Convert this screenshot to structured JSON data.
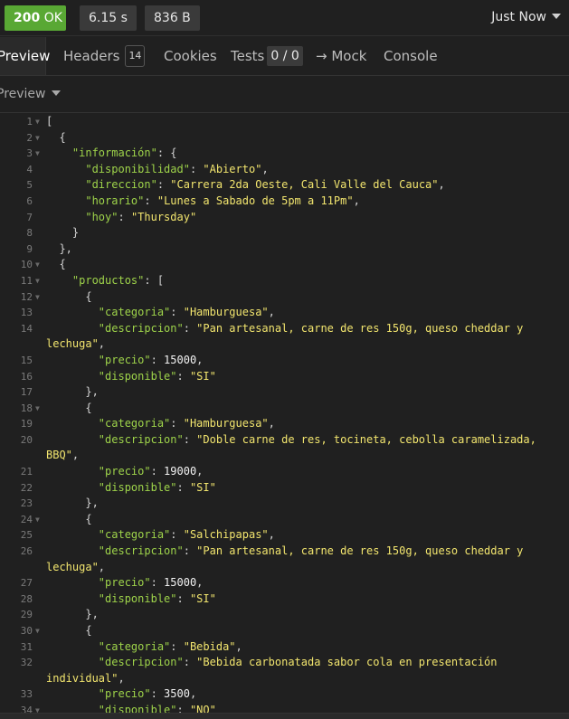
{
  "status": {
    "code": "200",
    "text": "OK",
    "time": "6.15 s",
    "size": "836 B",
    "timestamp": "Just Now"
  },
  "tabs": {
    "preview": "Preview",
    "headers": "Headers",
    "headers_count": "14",
    "cookies": "Cookies",
    "tests": "Tests",
    "tests_count": "0 / 0",
    "mock": "→ Mock",
    "console": "Console"
  },
  "preview_mode": "Preview",
  "colors": {
    "status_ok": "#59a834",
    "json_key": "#9ed34a",
    "json_string": "#f2e56e",
    "background": "#202020"
  },
  "icons": {
    "caret": "caret-down-icon",
    "fold": "fold-arrow-icon"
  },
  "code_lines": [
    {
      "n": "1",
      "fold": true,
      "t": [
        [
          "p",
          "["
        ]
      ]
    },
    {
      "n": "2",
      "fold": true,
      "t": [
        [
          "p",
          "  {"
        ]
      ]
    },
    {
      "n": "3",
      "fold": true,
      "t": [
        [
          "p",
          "    "
        ],
        [
          "k",
          "\"información\""
        ],
        [
          "p",
          ": {"
        ]
      ]
    },
    {
      "n": "4",
      "t": [
        [
          "p",
          "      "
        ],
        [
          "k",
          "\"disponibilidad\""
        ],
        [
          "p",
          ": "
        ],
        [
          "s",
          "\"Abierto\""
        ],
        [
          "p",
          ","
        ]
      ]
    },
    {
      "n": "5",
      "t": [
        [
          "p",
          "      "
        ],
        [
          "k",
          "\"direccion\""
        ],
        [
          "p",
          ": "
        ],
        [
          "s",
          "\"Carrera 2da Oeste, Cali Valle del Cauca\""
        ],
        [
          "p",
          ","
        ]
      ]
    },
    {
      "n": "6",
      "t": [
        [
          "p",
          "      "
        ],
        [
          "k",
          "\"horario\""
        ],
        [
          "p",
          ": "
        ],
        [
          "s",
          "\"Lunes a Sabado de 5pm a 11Pm\""
        ],
        [
          "p",
          ","
        ]
      ]
    },
    {
      "n": "7",
      "t": [
        [
          "p",
          "      "
        ],
        [
          "k",
          "\"hoy\""
        ],
        [
          "p",
          ": "
        ],
        [
          "s",
          "\"Thursday\""
        ]
      ]
    },
    {
      "n": "8",
      "t": [
        [
          "p",
          "    }"
        ]
      ]
    },
    {
      "n": "9",
      "t": [
        [
          "p",
          "  },"
        ]
      ]
    },
    {
      "n": "10",
      "fold": true,
      "t": [
        [
          "p",
          "  {"
        ]
      ]
    },
    {
      "n": "11",
      "fold": true,
      "t": [
        [
          "p",
          "    "
        ],
        [
          "k",
          "\"productos\""
        ],
        [
          "p",
          ": ["
        ]
      ]
    },
    {
      "n": "12",
      "fold": true,
      "t": [
        [
          "p",
          "      {"
        ]
      ]
    },
    {
      "n": "13",
      "t": [
        [
          "p",
          "        "
        ],
        [
          "k",
          "\"categoria\""
        ],
        [
          "p",
          ": "
        ],
        [
          "s",
          "\"Hamburguesa\""
        ],
        [
          "p",
          ","
        ]
      ]
    },
    {
      "n": "14",
      "t": [
        [
          "p",
          "        "
        ],
        [
          "k",
          "\"descripcion\""
        ],
        [
          "p",
          ": "
        ],
        [
          "s",
          "\"Pan artesanal, carne de res 150g, queso cheddar y"
        ]
      ]
    },
    {
      "n": "",
      "t": [
        [
          "s",
          "lechuga\""
        ],
        [
          "p",
          ","
        ]
      ]
    },
    {
      "n": "15",
      "t": [
        [
          "p",
          "        "
        ],
        [
          "k",
          "\"precio\""
        ],
        [
          "p",
          ": "
        ],
        [
          "n",
          "15000"
        ],
        [
          "p",
          ","
        ]
      ]
    },
    {
      "n": "16",
      "t": [
        [
          "p",
          "        "
        ],
        [
          "k",
          "\"disponible\""
        ],
        [
          "p",
          ": "
        ],
        [
          "s",
          "\"SI\""
        ]
      ]
    },
    {
      "n": "17",
      "t": [
        [
          "p",
          "      },"
        ]
      ]
    },
    {
      "n": "18",
      "fold": true,
      "t": [
        [
          "p",
          "      {"
        ]
      ]
    },
    {
      "n": "19",
      "t": [
        [
          "p",
          "        "
        ],
        [
          "k",
          "\"categoria\""
        ],
        [
          "p",
          ": "
        ],
        [
          "s",
          "\"Hamburguesa\""
        ],
        [
          "p",
          ","
        ]
      ]
    },
    {
      "n": "20",
      "t": [
        [
          "p",
          "        "
        ],
        [
          "k",
          "\"descripcion\""
        ],
        [
          "p",
          ": "
        ],
        [
          "s",
          "\"Doble carne de res, tocineta, cebolla caramelizada,"
        ]
      ]
    },
    {
      "n": "",
      "t": [
        [
          "s",
          "BBQ\""
        ],
        [
          "p",
          ","
        ]
      ]
    },
    {
      "n": "21",
      "t": [
        [
          "p",
          "        "
        ],
        [
          "k",
          "\"precio\""
        ],
        [
          "p",
          ": "
        ],
        [
          "n",
          "19000"
        ],
        [
          "p",
          ","
        ]
      ]
    },
    {
      "n": "22",
      "t": [
        [
          "p",
          "        "
        ],
        [
          "k",
          "\"disponible\""
        ],
        [
          "p",
          ": "
        ],
        [
          "s",
          "\"SI\""
        ]
      ]
    },
    {
      "n": "23",
      "t": [
        [
          "p",
          "      },"
        ]
      ]
    },
    {
      "n": "24",
      "fold": true,
      "t": [
        [
          "p",
          "      {"
        ]
      ]
    },
    {
      "n": "25",
      "t": [
        [
          "p",
          "        "
        ],
        [
          "k",
          "\"categoria\""
        ],
        [
          "p",
          ": "
        ],
        [
          "s",
          "\"Salchipapas\""
        ],
        [
          "p",
          ","
        ]
      ]
    },
    {
      "n": "26",
      "t": [
        [
          "p",
          "        "
        ],
        [
          "k",
          "\"descripcion\""
        ],
        [
          "p",
          ": "
        ],
        [
          "s",
          "\"Pan artesanal, carne de res 150g, queso cheddar y"
        ]
      ]
    },
    {
      "n": "",
      "t": [
        [
          "s",
          "lechuga\""
        ],
        [
          "p",
          ","
        ]
      ]
    },
    {
      "n": "27",
      "t": [
        [
          "p",
          "        "
        ],
        [
          "k",
          "\"precio\""
        ],
        [
          "p",
          ": "
        ],
        [
          "n",
          "15000"
        ],
        [
          "p",
          ","
        ]
      ]
    },
    {
      "n": "28",
      "t": [
        [
          "p",
          "        "
        ],
        [
          "k",
          "\"disponible\""
        ],
        [
          "p",
          ": "
        ],
        [
          "s",
          "\"SI\""
        ]
      ]
    },
    {
      "n": "29",
      "t": [
        [
          "p",
          "      },"
        ]
      ]
    },
    {
      "n": "30",
      "fold": true,
      "t": [
        [
          "p",
          "      {"
        ]
      ]
    },
    {
      "n": "31",
      "t": [
        [
          "p",
          "        "
        ],
        [
          "k",
          "\"categoria\""
        ],
        [
          "p",
          ": "
        ],
        [
          "s",
          "\"Bebida\""
        ],
        [
          "p",
          ","
        ]
      ]
    },
    {
      "n": "32",
      "t": [
        [
          "p",
          "        "
        ],
        [
          "k",
          "\"descripcion\""
        ],
        [
          "p",
          ": "
        ],
        [
          "s",
          "\"Bebida carbonatada sabor cola en presentación"
        ]
      ]
    },
    {
      "n": "",
      "t": [
        [
          "s",
          "individual\""
        ],
        [
          "p",
          ","
        ]
      ]
    },
    {
      "n": "33",
      "t": [
        [
          "p",
          "        "
        ],
        [
          "k",
          "\"precio\""
        ],
        [
          "p",
          ": "
        ],
        [
          "n",
          "3500"
        ],
        [
          "p",
          ","
        ]
      ]
    },
    {
      "n": "34",
      "fold": true,
      "t": [
        [
          "p",
          "        "
        ],
        [
          "k",
          "\"disponible\""
        ],
        [
          "p",
          ": "
        ],
        [
          "s",
          "\"NO\""
        ]
      ]
    }
  ]
}
